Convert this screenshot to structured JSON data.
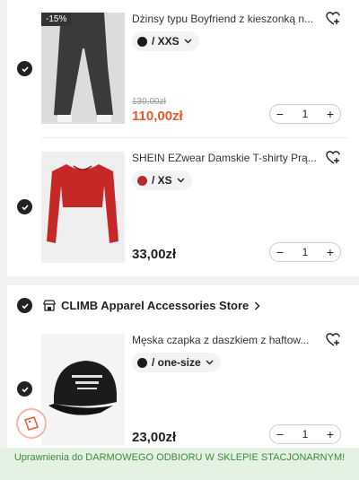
{
  "items": [
    {
      "title": "Dżinsy typu Boyfriend z kieszonką n...",
      "discount": "-15%",
      "color_hex": "#1a1a1a",
      "attr": "/ XXS",
      "old_price": "130,00zł",
      "price": "110,00zł",
      "price_color": "#e8582a",
      "qty": "1"
    },
    {
      "title": "SHEIN EZwear Damskie T-shirty Prą...",
      "color_hex": "#b52a2a",
      "attr": "/ XS",
      "price": "33,00zł",
      "price_color": "#222222",
      "qty": "1"
    },
    {
      "title": "Męska czapka z daszkiem z haftow...",
      "color_hex": "#1a1a1a",
      "attr": "/ one-size",
      "price": "23,00zł",
      "price_color": "#222222",
      "qty": "1"
    }
  ],
  "store": {
    "name": "CLIMB Apparel Accessories Store"
  },
  "banner": {
    "text": "Uprawnienia do DARMOWEGO ODBIORU W SKLEPIE STACJONARNYM!"
  },
  "icons": {
    "check": "check-icon",
    "wishlist": "heart-plus-icon",
    "store": "store-icon",
    "chevron": "chevron-down-icon",
    "coupon": "coupon-icon"
  }
}
